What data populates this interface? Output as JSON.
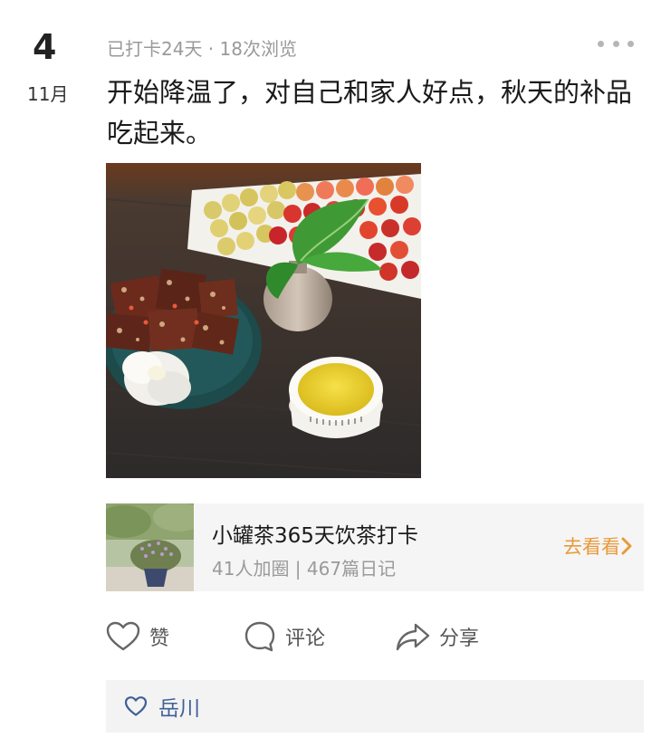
{
  "post": {
    "day": "4",
    "month": "11月",
    "meta": "已打卡24天 · 18次浏览",
    "text": "开始降温了，对自己和家人好点，秋天的补品吃起来。"
  },
  "circle": {
    "name": "小罐茶365天饮茶打卡",
    "stats": "41人加圈 | 467篇日记",
    "link_label": "去看看"
  },
  "actions": {
    "like": "赞",
    "comment": "评论",
    "share": "分享"
  },
  "likes": {
    "names": "岳川"
  },
  "colors": {
    "accent": "#e89a3a",
    "like_name": "#3f5f96",
    "muted": "#9a9a9a"
  },
  "icons": [
    "more-dots-icon",
    "heart-icon",
    "comment-bubble-icon",
    "share-arrow-icon",
    "chevron-right-icon",
    "heart-outline-small-icon"
  ]
}
